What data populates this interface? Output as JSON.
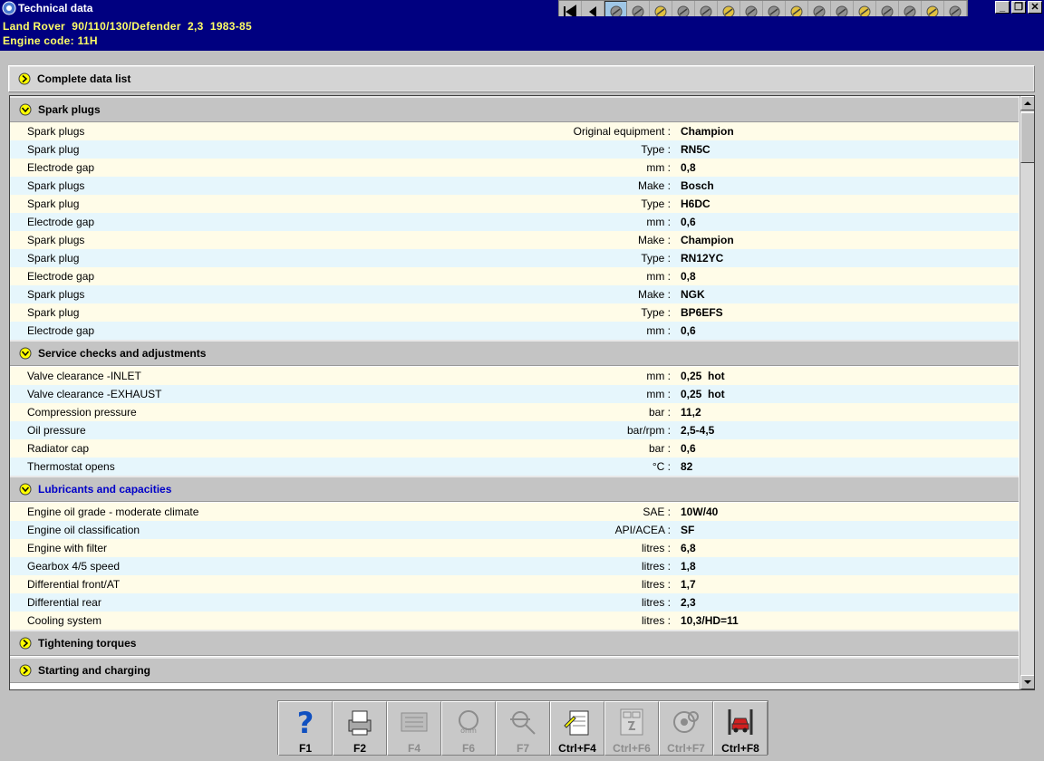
{
  "window": {
    "title": "Technical data"
  },
  "vehicle": {
    "line1": "Land Rover  90/110/130/Defender  2,3  1983-85",
    "line2": "Engine code: 11H"
  },
  "toolbar_icons": [
    "first-page-icon",
    "back-icon",
    "data-icon",
    "oil-icon",
    "spark-icon",
    "tool-icon",
    "chassis-icon",
    "engine-icon",
    "brush-icon",
    "fuse-icon",
    "panel-icon",
    "car-icon",
    "wheel-icon",
    "steering-icon",
    "globe-icon",
    "warning-icon",
    "gear-icon",
    "door-icon"
  ],
  "complete_list": {
    "label": "Complete data list"
  },
  "groups": {
    "spark": {
      "label": "Spark plugs",
      "rows": [
        {
          "desc": "Spark plugs",
          "unit": "Original equipment :",
          "value": "Champion"
        },
        {
          "desc": "Spark plug",
          "unit": "Type :",
          "value": "RN5C"
        },
        {
          "desc": "Electrode gap",
          "unit": "mm :",
          "value": "0,8"
        },
        {
          "desc": "Spark plugs",
          "unit": "Make :",
          "value": "Bosch"
        },
        {
          "desc": "Spark plug",
          "unit": "Type :",
          "value": "H6DC"
        },
        {
          "desc": "Electrode gap",
          "unit": "mm :",
          "value": "0,6"
        },
        {
          "desc": "Spark plugs",
          "unit": "Make :",
          "value": "Champion"
        },
        {
          "desc": "Spark plug",
          "unit": "Type :",
          "value": "RN12YC"
        },
        {
          "desc": "Electrode gap",
          "unit": "mm :",
          "value": "0,8"
        },
        {
          "desc": "Spark plugs",
          "unit": "Make :",
          "value": "NGK"
        },
        {
          "desc": "Spark plug",
          "unit": "Type :",
          "value": "BP6EFS"
        },
        {
          "desc": "Electrode gap",
          "unit": "mm :",
          "value": "0,6"
        }
      ]
    },
    "service": {
      "label": "Service checks and adjustments",
      "rows": [
        {
          "desc": "Valve clearance  -INLET",
          "unit": "mm :",
          "value": "0,25  hot"
        },
        {
          "desc": "Valve clearance  -EXHAUST",
          "unit": "mm :",
          "value": "0,25  hot"
        },
        {
          "desc": "Compression pressure",
          "unit": "bar :",
          "value": "11,2"
        },
        {
          "desc": "Oil pressure",
          "unit": "bar/rpm :",
          "value": "2,5-4,5"
        },
        {
          "desc": "Radiator cap",
          "unit": "bar :",
          "value": "0,6"
        },
        {
          "desc": "Thermostat opens",
          "unit": "°C :",
          "value": "82"
        }
      ]
    },
    "lubricants": {
      "label": "Lubricants and capacities",
      "rows": [
        {
          "desc": "Engine oil grade - moderate climate",
          "unit": "SAE :",
          "value": "10W/40"
        },
        {
          "desc": "Engine oil classification",
          "unit": "API/ACEA :",
          "value": "SF"
        },
        {
          "desc": "Engine with filter",
          "unit": "litres :",
          "value": "6,8"
        },
        {
          "desc": "Gearbox 4/5 speed",
          "unit": "litres :",
          "value": "1,8"
        },
        {
          "desc": "Differential front/AT",
          "unit": "litres :",
          "value": "1,7"
        },
        {
          "desc": "Differential rear",
          "unit": "litres :",
          "value": "2,3"
        },
        {
          "desc": "Cooling system",
          "unit": "litres :",
          "value": "10,3/HD=11"
        }
      ]
    },
    "torques": {
      "label": "Tightening torques"
    },
    "charging": {
      "label": "Starting and charging"
    }
  },
  "fkeys": [
    {
      "label": "F1",
      "icon": "help-icon",
      "enabled": true
    },
    {
      "label": "F2",
      "icon": "printer-icon",
      "enabled": true
    },
    {
      "label": "F4",
      "icon": "list-icon",
      "enabled": false
    },
    {
      "label": "F6",
      "icon": "diagnostic-icon",
      "enabled": false
    },
    {
      "label": "F7",
      "icon": "search-icon",
      "enabled": false
    },
    {
      "label": "Ctrl+F4",
      "icon": "notes-icon",
      "enabled": true
    },
    {
      "label": "Ctrl+F6",
      "icon": "circuit-icon",
      "enabled": false
    },
    {
      "label": "Ctrl+F7",
      "icon": "wheel-search-icon",
      "enabled": false
    },
    {
      "label": "Ctrl+F8",
      "icon": "car-lift-icon",
      "enabled": true
    }
  ],
  "colors": {
    "header_bg": "#000080",
    "header_text": "#ffff66",
    "row_yellow": "#fffce8",
    "row_blue": "#e6f6fc",
    "chevron": "#ffff00"
  }
}
